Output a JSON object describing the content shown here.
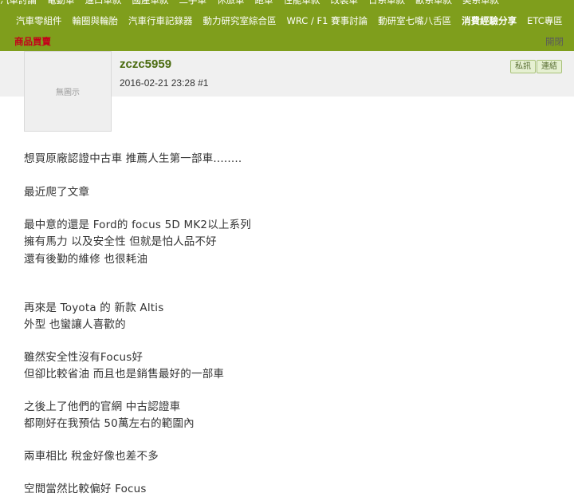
{
  "nav": {
    "row0": [
      "汽車討論",
      "電動車",
      "進口車款",
      "國產車款",
      "二手車",
      "休旅車",
      "跑車",
      "性能車款",
      "改裝車",
      "日系車款",
      "歐系車款",
      "美系車款"
    ],
    "row1": [
      "汽車零組件",
      "輪圈與輪胎",
      "汽車行車記錄器",
      "動力研究室綜合區",
      "WRC / F1 賽事討論",
      "動研室七嘴八舌區"
    ],
    "row1_bold": "消費經驗分享",
    "row1_last": "ETC專區",
    "row2_sale": "商品買賣",
    "row2_right": "開閉"
  },
  "post": {
    "username": "zczc5959",
    "date": "2016-02-21 23:28",
    "floor": "#1",
    "avatar_text": "無圖示",
    "pm_button": "私訊",
    "link_button": "連結"
  },
  "content": [
    "想買原廠認證中古車 推薦人生第一部車........",
    "最近爬了文章",
    "最中意的還是 Ford的 focus 5D MK2以上系列",
    "擁有馬力 以及安全性 但就是怕人品不好",
    "還有後勤的維修 也很耗油",
    "再來是 Toyota 的 新款 Altis",
    "外型 也蠻讓人喜歡的",
    "雖然安全性沒有Focus好",
    "但卻比較省油 而且也是銷售最好的一部車",
    "之後上了他們的官網 中古認證車",
    "都剛好在我預估 50萬左右的範圍內",
    "兩車相比 稅金好像也差不多",
    "空間當然比較偏好 Focus"
  ]
}
